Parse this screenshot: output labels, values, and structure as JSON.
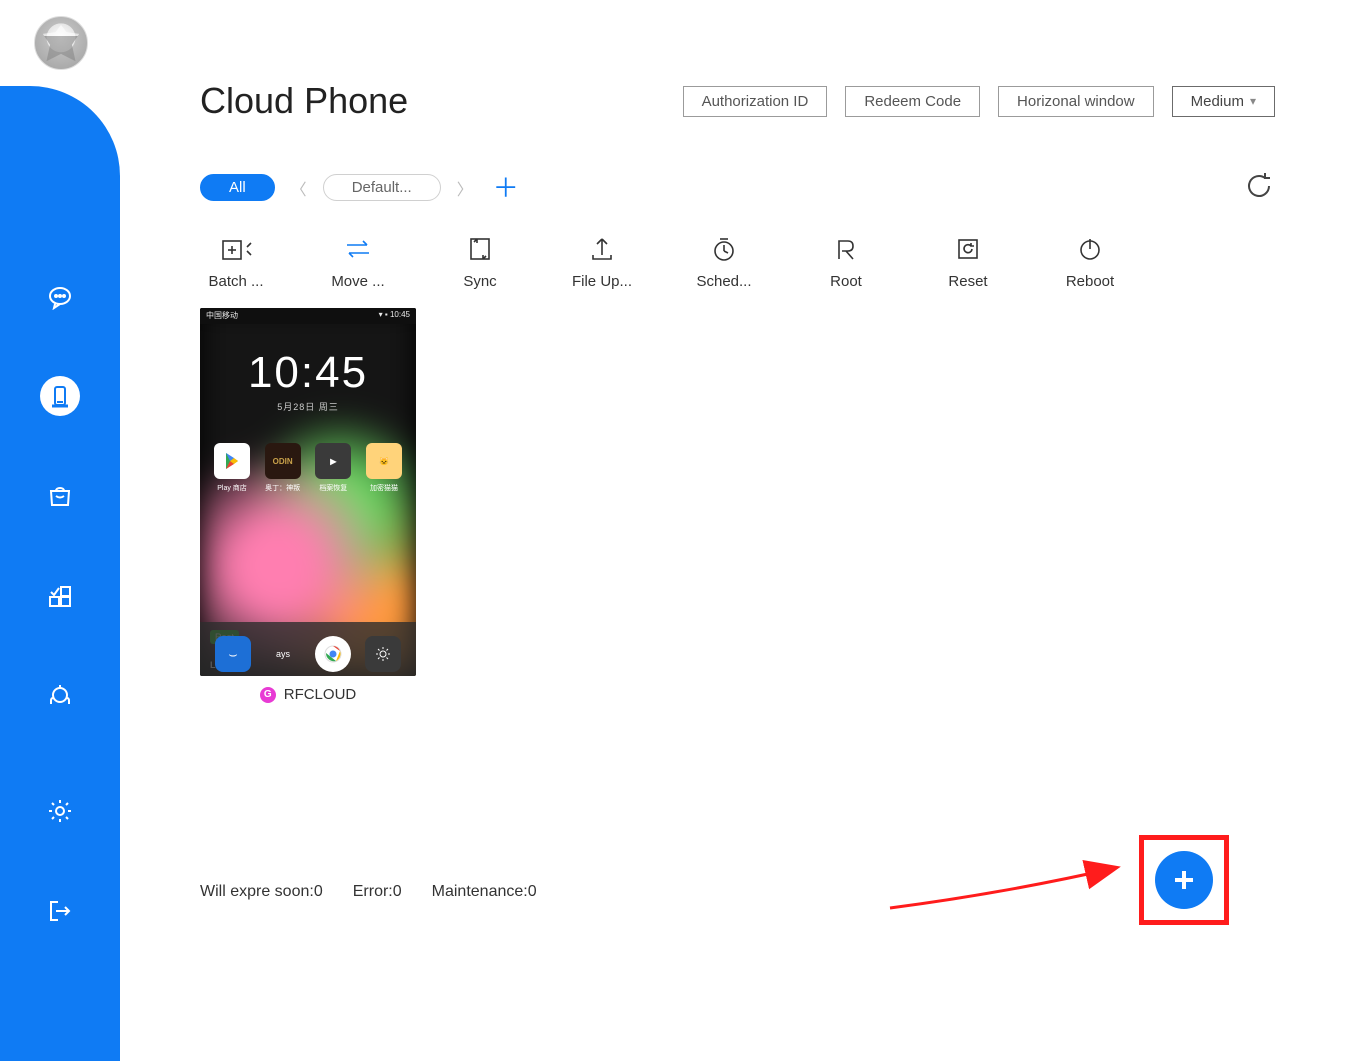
{
  "window": {
    "title": "Cloud Phone"
  },
  "header": {
    "buttons": {
      "authorization": "Authorization ID",
      "redeem": "Redeem Code",
      "horizontal": "Horizonal window",
      "size_label": "Medium"
    }
  },
  "filter": {
    "all": "All",
    "default": "Default..."
  },
  "toolbar": {
    "batch": "Batch ...",
    "move": "Move ...",
    "sync": "Sync",
    "upload": "File Up...",
    "schedule": "Sched...",
    "root": "Root",
    "reset": "Reset",
    "reboot": "Reboot"
  },
  "device": {
    "name": "RFCLOUD",
    "clock": "10:45",
    "clock_sub": "5月28日  周三",
    "statusbar_right": "▾ ▪ 10:45",
    "apps": {
      "a": "Play 商店",
      "b": "奥丁：神叛",
      "c": "档案恢复",
      "d": "加密猫猫"
    },
    "root_label": "Root",
    "left_time": "Left Time",
    "days": "ays"
  },
  "status": {
    "expire_label": "Will expre soon:",
    "expire_val": "0",
    "error_label": "Error:",
    "error_val": "0",
    "maint_label": "Maintenance:",
    "maint_val": "0"
  }
}
